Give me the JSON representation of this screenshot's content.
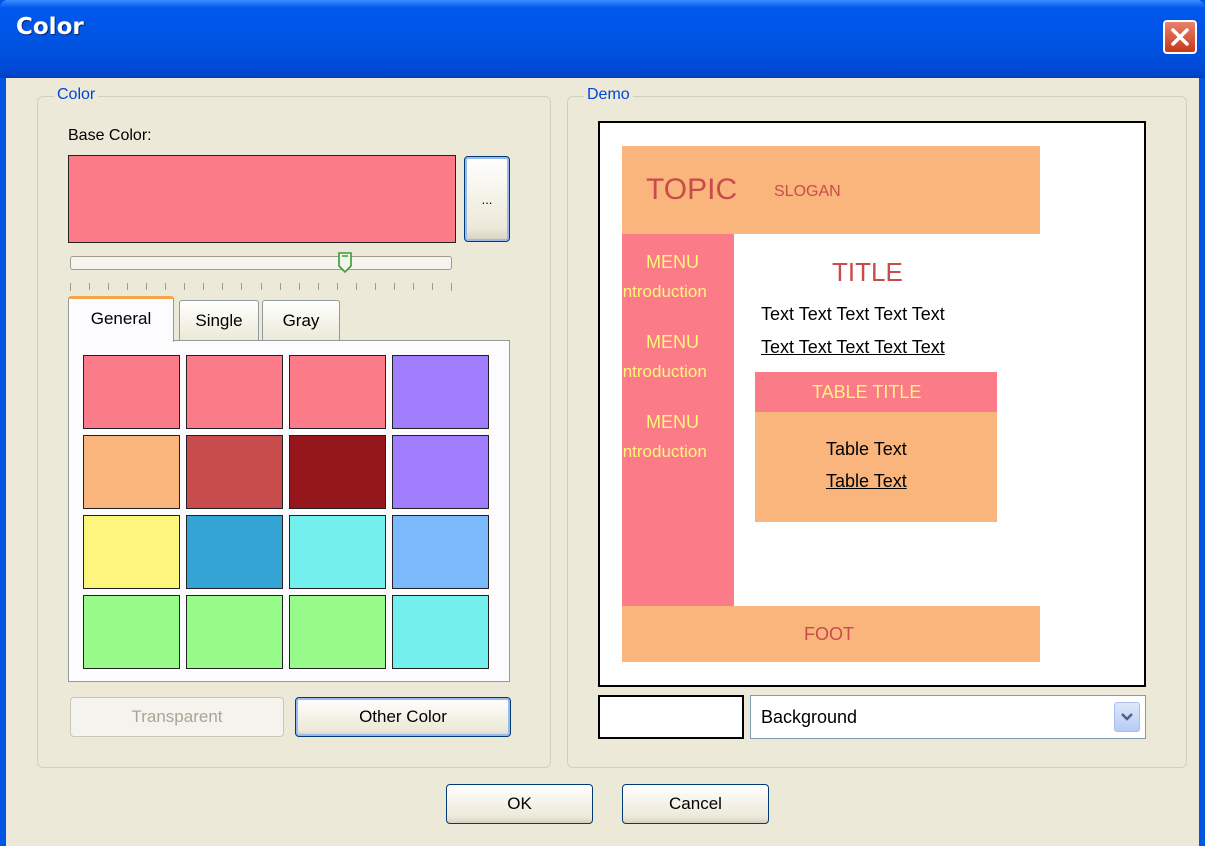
{
  "window": {
    "title": "Color"
  },
  "color_group": {
    "label": "Color",
    "base_color_label": "Base Color:",
    "base_color": "#fc7b89",
    "browse_button": "...",
    "slider_level": 0.72,
    "tabs": [
      {
        "label": "General",
        "active": true
      },
      {
        "label": "Single",
        "active": false
      },
      {
        "label": "Gray",
        "active": false
      }
    ],
    "palette": [
      [
        "#fc7b89",
        "#fc7b89",
        "#fc7b89",
        "#9f7dfd"
      ],
      [
        "#fab57c",
        "#c84c4c",
        "#95171c",
        "#9f7dfd"
      ],
      [
        "#fdf67c",
        "#34a4d4",
        "#73f0ee",
        "#7cb9fb"
      ],
      [
        "#97fb8a",
        "#97fb8a",
        "#97fb8a",
        "#73f0ee"
      ]
    ],
    "transparent_button": "Transparent",
    "other_color_button": "Other Color"
  },
  "demo_group": {
    "label": "Demo",
    "topic": "TOPIC",
    "slogan": "SLOGAN",
    "menu_items": [
      {
        "menu": "MENU",
        "intro": "Introduction"
      },
      {
        "menu": "MENU",
        "intro": "Introduction"
      },
      {
        "menu": "MENU",
        "intro": "Introduction"
      }
    ],
    "title": "TITLE",
    "text_line": "Text Text Text Text Text",
    "text_link": "Text Text Text Text Text",
    "table_title": "TABLE TITLE",
    "table_text": "Table Text",
    "table_link": "Table Text",
    "foot": "FOOT",
    "bg_swatch_color": "#ffffff",
    "target_select": "Background",
    "colors": {
      "accent": "#fab57c",
      "primary": "#fc7b89",
      "heading": "#c84c4c",
      "menu_text": "#fdf67c"
    }
  },
  "footer": {
    "ok": "OK",
    "cancel": "Cancel"
  }
}
